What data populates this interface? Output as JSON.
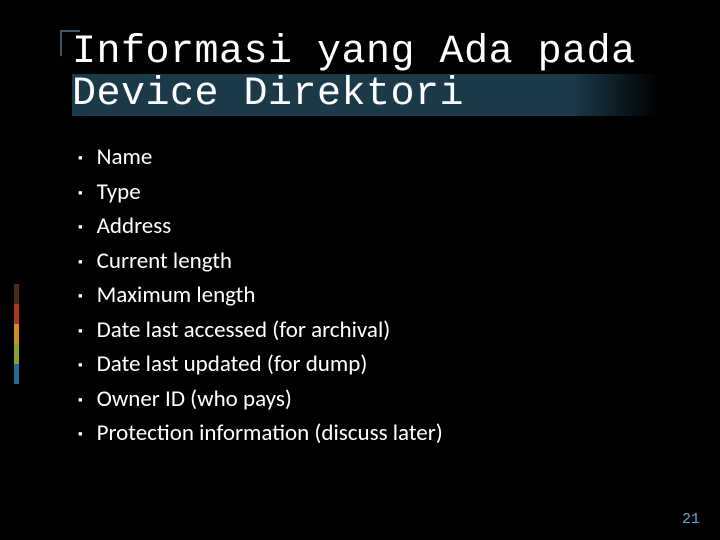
{
  "title": "Informasi yang Ada pada Device Direktori",
  "bullets": [
    "Name",
    "Type",
    "Address",
    "Current length",
    "Maximum length",
    "Date last accessed (for archival)",
    "Date last updated (for dump)",
    "Owner ID (who pays)",
    "Protection information (discuss later)"
  ],
  "page_number": "21"
}
